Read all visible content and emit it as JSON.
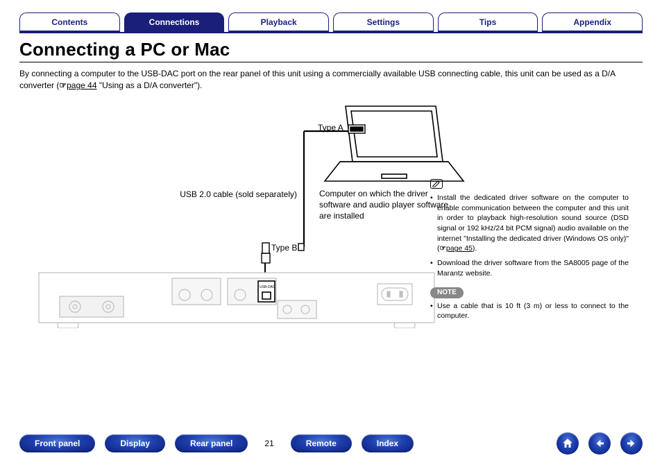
{
  "tabs": {
    "contents": {
      "label": "Contents"
    },
    "connections": {
      "label": "Connections"
    },
    "playback": {
      "label": "Playback"
    },
    "settings": {
      "label": "Settings"
    },
    "tips": {
      "label": "Tips"
    },
    "appendix": {
      "label": "Appendix"
    }
  },
  "title": "Connecting a PC or Mac",
  "intro": {
    "text_a": "By connecting a computer to the USB-DAC port on the rear panel of this unit using a commercially available USB connecting cable, this unit can be used as a D/A converter (",
    "link": "page 44",
    "text_b": " \"Using as a D/A converter\")."
  },
  "diagram": {
    "type_a": "Type A",
    "type_b": "Type B",
    "usb_cable": "USB 2.0 cable (sold separately)",
    "computer": "Computer on which the driver software and audio player software are installed",
    "usb_dac_label": "USB-DAC"
  },
  "side": {
    "bullet1_a": "Install the dedicated driver software on the computer to enable communication between the computer and this unit in order to playback high-resolution sound source (DSD signal or 192 kHz/24 bit PCM signal) audio available on the internet \"Installing the dedicated driver (Windows OS only)\" (",
    "bullet1_link": "page 45",
    "bullet1_b": ").",
    "bullet2": "Download the driver software from the SA8005 page of the Marantz website.",
    "note_label": "NOTE",
    "note_bullet": "Use a cable that is 10 ft (3 m) or less to connect to the computer."
  },
  "bottom": {
    "front_panel": "Front panel",
    "display": "Display",
    "rear_panel": "Rear panel",
    "remote": "Remote",
    "index": "Index",
    "page_number": "21"
  },
  "icons": {
    "pencil": "pencil-icon",
    "pointer": "pointer-icon",
    "home": "home-icon",
    "prev": "arrow-left-icon",
    "next": "arrow-right-icon"
  }
}
